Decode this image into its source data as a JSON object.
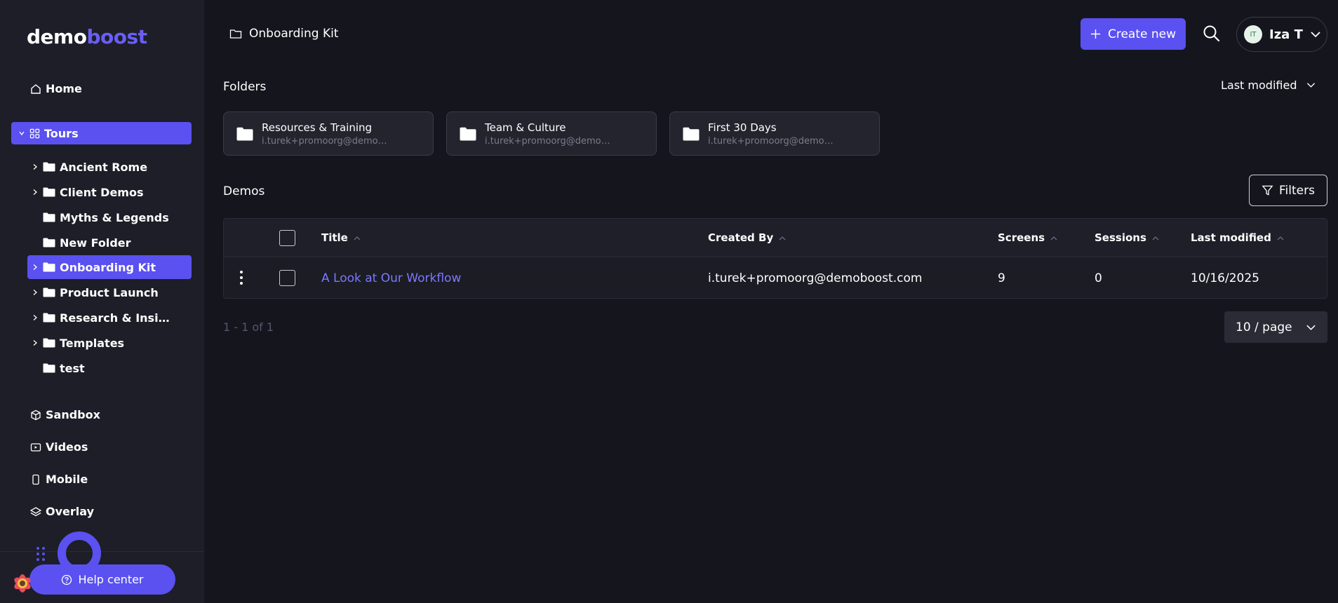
{
  "app": {
    "logo_part1": "demo",
    "logo_part2": "boost"
  },
  "sidebar": {
    "home": "Home",
    "tours": "Tours",
    "tree": [
      {
        "label": "Ancient Rome",
        "expandable": true
      },
      {
        "label": "Client Demos",
        "expandable": true
      },
      {
        "label": "Myths & Legends",
        "expandable": false
      },
      {
        "label": "New Folder",
        "expandable": false
      },
      {
        "label": "Onboarding Kit",
        "expandable": true,
        "active": true
      },
      {
        "label": "Product Launch",
        "expandable": true
      },
      {
        "label": "Research & Insigh...",
        "expandable": true
      },
      {
        "label": "Templates",
        "expandable": true
      },
      {
        "label": "test",
        "expandable": false
      }
    ],
    "sandbox": "Sandbox",
    "videos": "Videos",
    "mobile": "Mobile",
    "overlay": "Overlay",
    "help": "Help center"
  },
  "header": {
    "breadcrumb": "Onboarding Kit",
    "create_label": "Create new",
    "user_initials": "IT",
    "user_name": "Iza T"
  },
  "folders": {
    "heading": "Folders",
    "sort_label": "Last modified",
    "items": [
      {
        "name": "Resources & Training",
        "owner": "i.turek+promoorg@demob..."
      },
      {
        "name": "Team & Culture",
        "owner": "i.turek+promoorg@demob..."
      },
      {
        "name": "First 30 Days",
        "owner": "i.turek+promoorg@demob..."
      }
    ]
  },
  "demos": {
    "heading": "Demos",
    "filters_label": "Filters",
    "columns": {
      "title": "Title",
      "created_by": "Created By",
      "screens": "Screens",
      "sessions": "Sessions",
      "last_modified": "Last modified"
    },
    "rows": [
      {
        "title": "A Look at Our Workflow",
        "created_by": "i.turek+promoorg@demoboost.com",
        "screens": "9",
        "sessions": "0",
        "last_modified": "10/16/2025"
      }
    ],
    "pager_text": "1 - 1 of 1",
    "page_size": "10 / page"
  },
  "colors": {
    "accent": "#5a51f0",
    "link": "#7e77ff",
    "background": "#15161d",
    "sidebar": "#1d1e27"
  }
}
